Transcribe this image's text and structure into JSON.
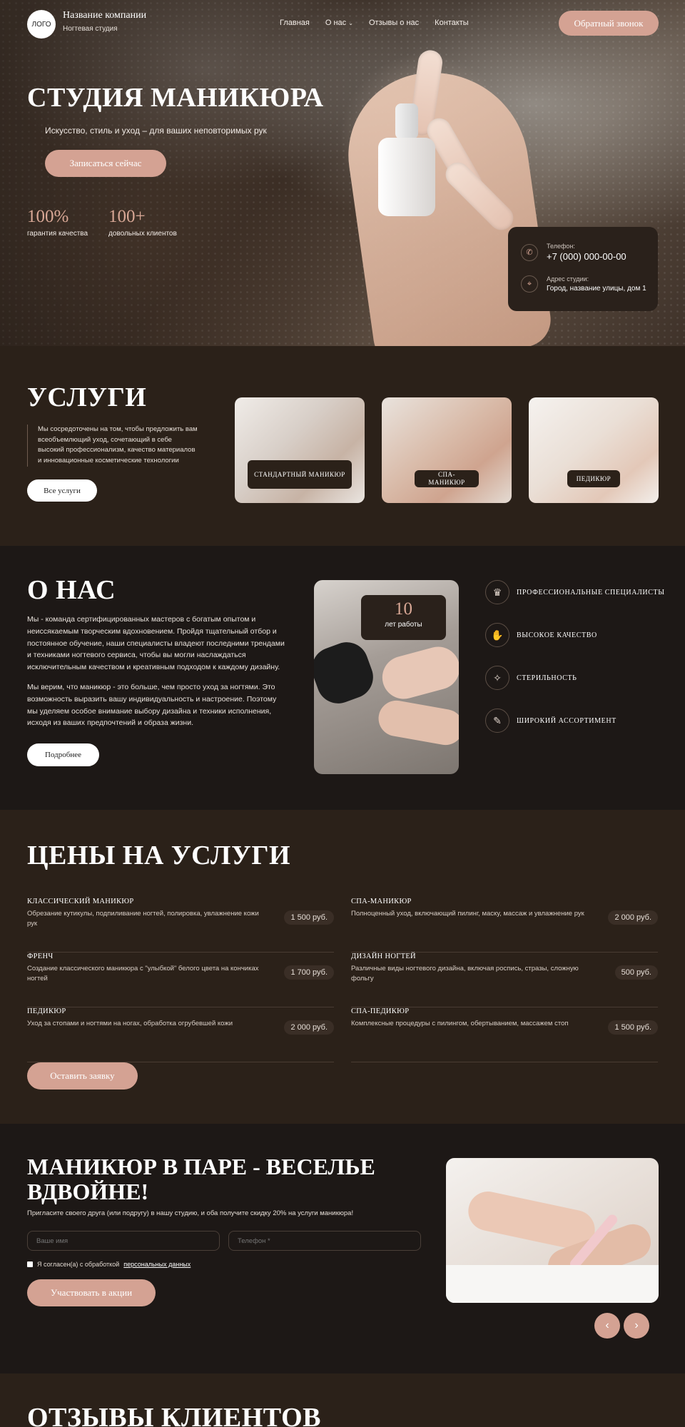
{
  "header": {
    "logo": "ЛОГО",
    "company_name": "Название компании",
    "company_sub": "Ногтевая студия",
    "nav": [
      "Главная",
      "О нас",
      "Отзывы о нас",
      "Контакты"
    ],
    "nav_dropdown_icon": "chevron-down-icon",
    "callback_label": "Обратный звонок"
  },
  "hero": {
    "title": "СТУДИЯ МАНИКЮРА",
    "subtitle": "Искусство, стиль и уход – для ваших неповторимых рук",
    "cta": "Записаться сейчас",
    "stats": [
      {
        "value": "100%",
        "label": "гарантия качества"
      },
      {
        "value": "100+",
        "label": "довольных клиентов"
      }
    ],
    "contact": {
      "phone_label": "Телефон:",
      "phone": "+7 (000) 000-00-00",
      "address_label": "Адрес студии:",
      "address": "Город, название улицы, дом 1"
    }
  },
  "services": {
    "title": "Услуги",
    "description": "Мы сосредоточены на том, чтобы предложить вам всеобъемлющий уход, сочетающий в себе высокий профессионализм, качество материалов и инновационные косметические технологии",
    "all_label": "Все услуги",
    "cards": [
      {
        "label": "Стандартный маникюр"
      },
      {
        "label": "СПА-маникюр"
      },
      {
        "label": "Педикюр"
      }
    ]
  },
  "about": {
    "title": "О нас",
    "p1": "Мы - команда сертифицированных мастеров с богатым опытом и неиссякаемым творческим вдохновением. Пройдя тщательный отбор и постоянное обучение, наши специалисты владеют последними трендами и техниками ногтевого сервиса, чтобы вы могли наслаждаться исключительным качеством и креативным подходом к каждому дизайну.",
    "p2": "Мы верим, что маникюр - это больше, чем просто уход за ногтями. Это возможность выразить вашу индивидуальность и настроение. Поэтому мы уделяем особое внимание выбору дизайна и техники исполнения, исходя из ваших предпочтений и образа жизни.",
    "more_label": "Подробнее",
    "years_value": "10",
    "years_label": "лет работы",
    "features": [
      {
        "icon": "specialists-icon",
        "label": "Профессиональные специалисты"
      },
      {
        "icon": "quality-icon",
        "label": "Высокое качество"
      },
      {
        "icon": "sterility-icon",
        "label": "Стерильность"
      },
      {
        "icon": "assortment-icon",
        "label": "Широкий ассортимент"
      }
    ]
  },
  "prices": {
    "title": "Цены на услуги",
    "items": [
      {
        "name": "Классический маникюр",
        "desc": "Обрезание кутикулы, подпиливание ногтей, полировка, увлажнение кожи рук",
        "price": "1 500 руб."
      },
      {
        "name": "СПА-маникюр",
        "desc": "Полноценный уход, включающий пилинг, маску, массаж и увлажнение рук",
        "price": "2 000 руб."
      },
      {
        "name": "Френч",
        "desc": "Создание классического маникюра с \"улыбкой\" белого цвета на кончиках ногтей",
        "price": "1 700 руб."
      },
      {
        "name": "Дизайн ногтей",
        "desc": "Различные виды ногтевого дизайна, включая роспись, стразы, сложную фольгу",
        "price": "500 руб."
      },
      {
        "name": "Педикюр",
        "desc": "Уход за стопами и ногтями на ногах, обработка огрубевшей кожи",
        "price": "2 000 руб."
      },
      {
        "name": "СПА-педикюр",
        "desc": "Комплексные процедуры с пилингом, обертыванием, массажем стоп",
        "price": "1 500 руб."
      }
    ],
    "order_label": "Оставить заявку"
  },
  "promo": {
    "title": "Маникюр в паре - веселье вдвойне!",
    "subtitle": "Пригласите своего друга (или подругу) в нашу студию, и оба получите скидку 20% на услуги маникюра!",
    "name_placeholder": "Ваше имя",
    "phone_placeholder": "Телефон *",
    "agree_text": "Я согласен(а) с обработкой",
    "agree_link": "персональных данных",
    "cta": "Участвовать в акции"
  },
  "reviews": {
    "title": "Отзывы клиентов"
  },
  "colors": {
    "accent": "#d4a293",
    "dark": "#1d1816",
    "brown": "#2b2119"
  }
}
